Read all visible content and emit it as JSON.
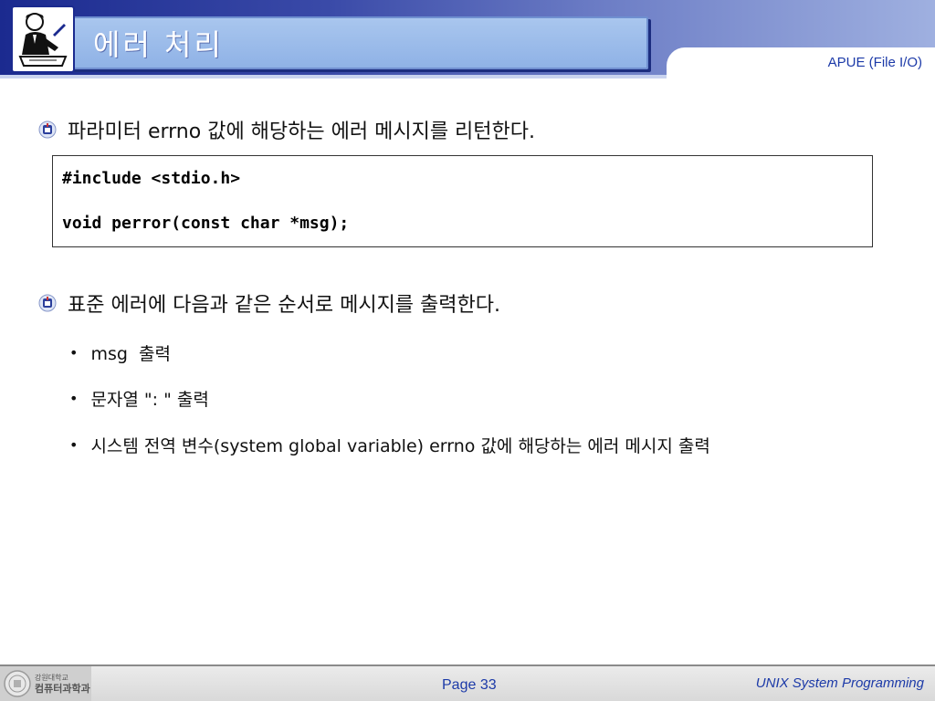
{
  "header": {
    "title": "에러 처리",
    "section": "APUE (File I/O)",
    "logo_icon": "writer-at-desk-icon"
  },
  "colors": {
    "header_dark": "#1b2a8f",
    "title_box": "#a9c6ee",
    "accent_text": "#1c3aa8"
  },
  "content": {
    "bullet1": "파라미터 errno 값에 해당하는 에러 메시지를 리턴한다.",
    "code": {
      "line1": "#include <stdio.h>",
      "line2": "void perror(const char *msg);"
    },
    "bullet2": "표준 에러에 다음과 같은 순서로 메시지를 출력한다.",
    "sub_items": [
      "msg  출력",
      "문자열 \": \" 출력",
      "시스템 전역 변수(system global variable) errno 값에 해당하는 에러 메시지 출력"
    ],
    "bullet_icon": "school-emblem-icon"
  },
  "footer": {
    "univ_top": "강원대학교",
    "univ_dept": "컴퓨터과학과",
    "page": "Page 33",
    "course": "UNIX System Programming",
    "emblem_icon": "university-seal-icon"
  }
}
